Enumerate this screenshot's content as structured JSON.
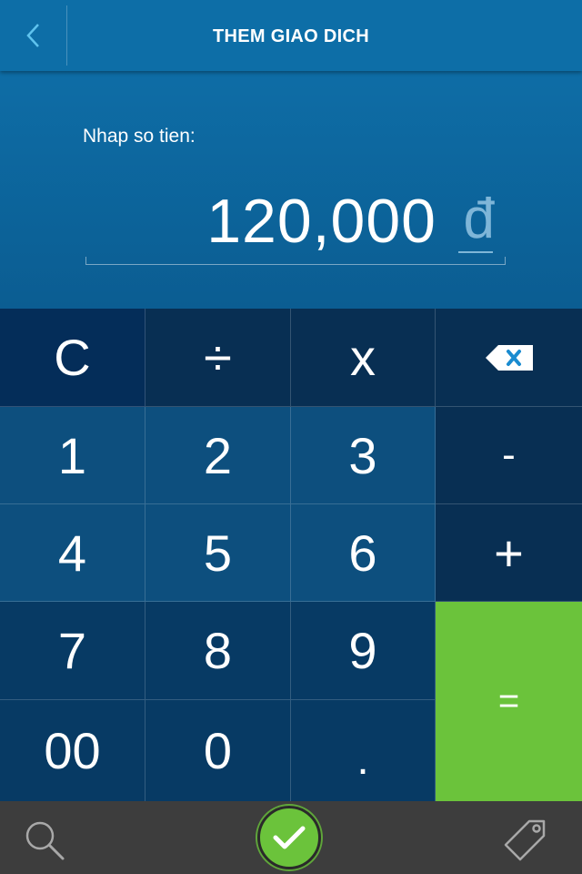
{
  "header": {
    "title": "THEM GIAO DICH",
    "back_icon": "chevron-left-icon"
  },
  "amount": {
    "label": "Nhap so tien:",
    "value": "120,000",
    "currency": "đ"
  },
  "keypad": {
    "clear": "C",
    "divide": "÷",
    "multiply": "x",
    "backspace_icon": "backspace-icon",
    "one": "1",
    "two": "2",
    "three": "3",
    "minus": "-",
    "four": "4",
    "five": "5",
    "six": "6",
    "plus": "+",
    "seven": "7",
    "eight": "8",
    "nine": "9",
    "equals": "=",
    "double_zero": "00",
    "zero": "0",
    "dot": "."
  },
  "bottom_bar": {
    "search_icon": "search-icon",
    "confirm_icon": "checkmark-icon",
    "tag_icon": "tag-icon"
  },
  "colors": {
    "header": "#0d6ea7",
    "accent_green": "#6bc33b",
    "key_light": "#0d4f7e",
    "key_dark": "#073a64",
    "bottom_bar": "#3d3d3d"
  }
}
